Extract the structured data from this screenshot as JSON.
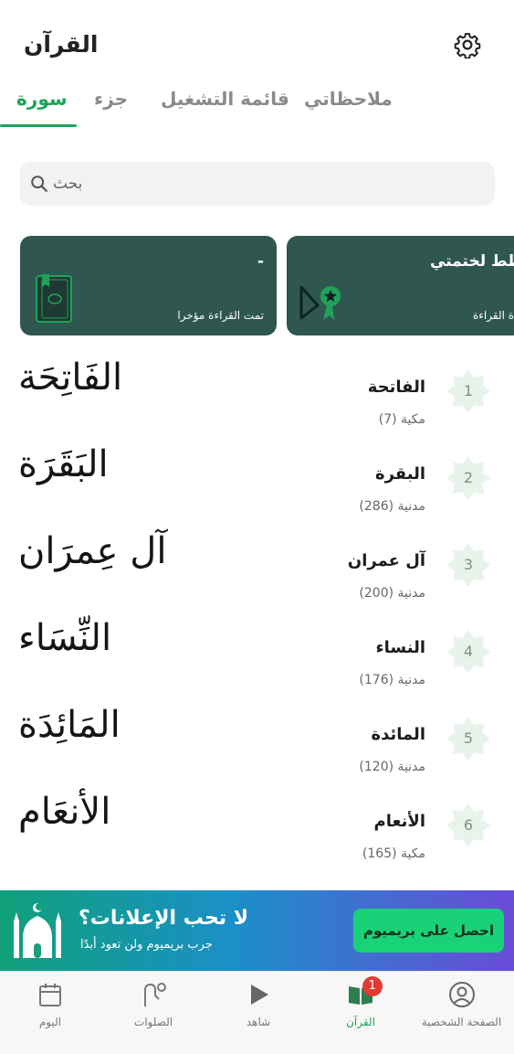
{
  "header": {
    "title": "القرآن",
    "settings_icon": "gear-icon"
  },
  "tabs": [
    {
      "label": "سورة",
      "active": true
    },
    {
      "label": "جزء",
      "active": false
    },
    {
      "label": "قائمة التشغيل",
      "active": false
    },
    {
      "label": "ملاحظاتي",
      "active": false
    }
  ],
  "search": {
    "placeholder": "بحث",
    "icon": "search-icon"
  },
  "cards": {
    "last_read": {
      "title": "-",
      "subtitle": "تمت القراءة مؤخرا",
      "icon": "quran-book-icon"
    },
    "khatm_plan": {
      "title": "طط لختمتي",
      "subtitle": "ة القراءة",
      "icon": "ribbon-badge-icon"
    }
  },
  "surahs": [
    {
      "number": "1",
      "name": "الفاتحة",
      "meta": "مكية (7)",
      "calligraphy": "الفَاتِحَة"
    },
    {
      "number": "2",
      "name": "البقرة",
      "meta": "مدنية (286)",
      "calligraphy": "البَقَرَة"
    },
    {
      "number": "3",
      "name": "آل عمران",
      "meta": "مدنية (200)",
      "calligraphy": "آل عِمرَان"
    },
    {
      "number": "4",
      "name": "النساء",
      "meta": "مدنية (176)",
      "calligraphy": "النِّسَاء"
    },
    {
      "number": "5",
      "name": "المائدة",
      "meta": "مدنية (120)",
      "calligraphy": "المَائِدَة"
    },
    {
      "number": "6",
      "name": "الأنعام",
      "meta": "مكية (165)",
      "calligraphy": "الأنعَام"
    }
  ],
  "banner": {
    "title": "لا تحب الإعلانات؟",
    "subtitle": "جرب بريميوم ولن تعود أبدًا",
    "button": "احصل على بريميوم",
    "icon": "mosque-icon"
  },
  "bottom_nav": [
    {
      "label": "الصفحة الشخصية",
      "icon": "profile-icon",
      "active": false
    },
    {
      "label": "القرآن",
      "icon": "quran-book-icon",
      "active": true,
      "badge": "1"
    },
    {
      "label": "شاهد",
      "icon": "play-icon",
      "active": false
    },
    {
      "label": "الصلوات",
      "icon": "prayer-icon",
      "active": false
    },
    {
      "label": "اليوم",
      "icon": "calendar-icon",
      "active": false
    }
  ],
  "colors": {
    "accent": "#1fa35a",
    "card_bg": "#2f5750",
    "star_bg": "#e8f3ec",
    "badge": "#e53935",
    "premium_button": "#19d278"
  }
}
